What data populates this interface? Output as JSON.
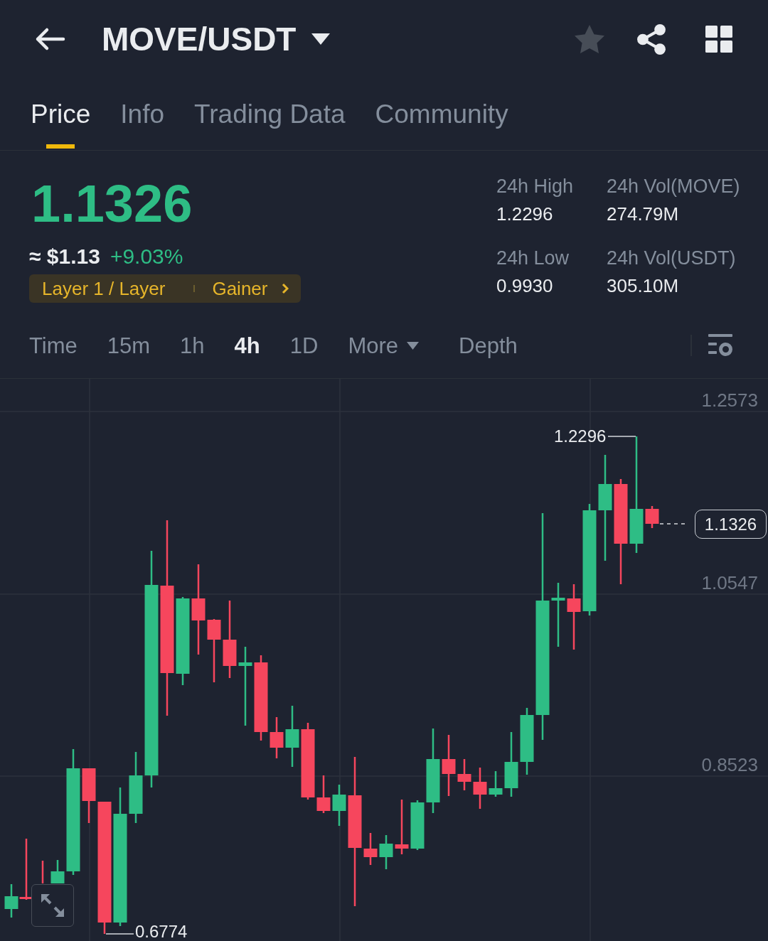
{
  "header": {
    "title": "MOVE/USDT",
    "favorite": false
  },
  "tabs": [
    {
      "label": "Price",
      "selected": true
    },
    {
      "label": "Info",
      "selected": false
    },
    {
      "label": "Trading Data",
      "selected": false
    },
    {
      "label": "Community",
      "selected": false
    }
  ],
  "ticker": {
    "price": "1.1326",
    "fiat_price": "≈ $1.13",
    "change": "+9.03%",
    "tags": [
      "Layer 1 / Layer",
      "Gainer"
    ]
  },
  "stats": [
    {
      "label": "24h High",
      "value": "1.2296"
    },
    {
      "label": "24h Vol(MOVE)",
      "value": "274.79M"
    },
    {
      "label": "24h Low",
      "value": "0.9930"
    },
    {
      "label": "24h Vol(USDT)",
      "value": "305.10M"
    }
  ],
  "intervals": [
    {
      "label": "Time",
      "kind": "option",
      "selected": false
    },
    {
      "label": "15m",
      "kind": "option",
      "selected": false
    },
    {
      "label": "1h",
      "kind": "option",
      "selected": false
    },
    {
      "label": "4h",
      "kind": "option",
      "selected": true
    },
    {
      "label": "1D",
      "kind": "option",
      "selected": false
    },
    {
      "label": "More",
      "kind": "menu",
      "selected": false
    },
    {
      "label": "Depth",
      "kind": "view",
      "selected": false
    }
  ],
  "chart": {
    "price_ticks": [
      "1.2573",
      "1.0547",
      "0.8523"
    ],
    "high_label": "1.2296",
    "low_label": "0.6774",
    "last_price": "1.1326"
  }
}
